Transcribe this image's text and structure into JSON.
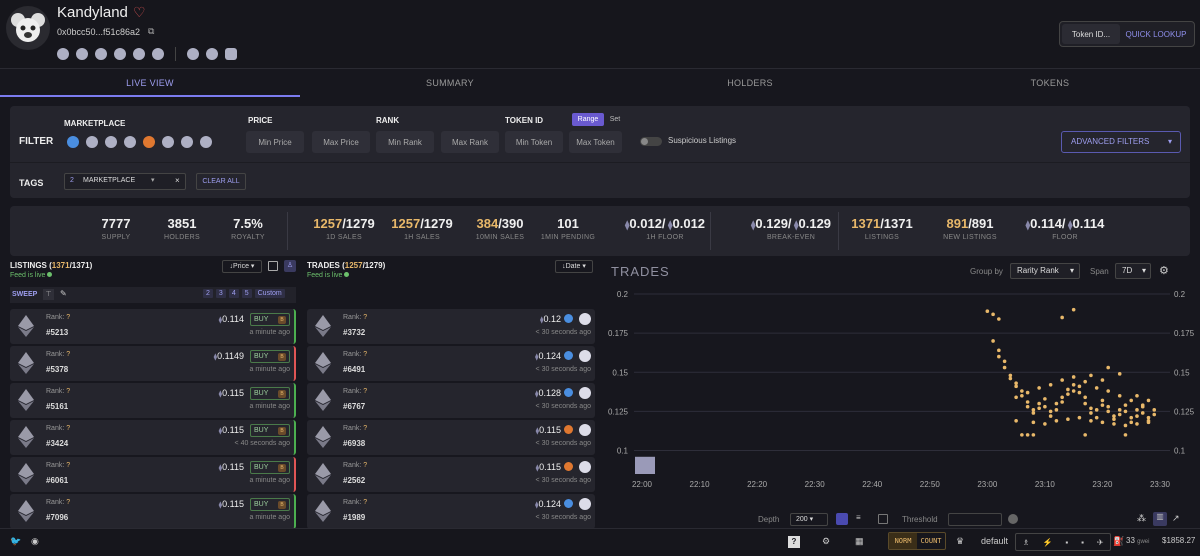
{
  "header": {
    "collection_name": "Kandyland",
    "address": "0x0bcc50...f51c86a2",
    "lookup_placeholder": "Token ID...",
    "lookup_button": "QUICK LOOKUP"
  },
  "tabs": [
    "LIVE VIEW",
    "SUMMARY",
    "HOLDERS",
    "TOKENS"
  ],
  "filter": {
    "title": "FILTER",
    "marketplace_label": "MARKETPLACE",
    "price_label": "PRICE",
    "rank_label": "RANK",
    "token_label": "TOKEN ID",
    "range_btn": "Range",
    "set_btn": "Set",
    "min_price": "Min Price",
    "max_price": "Max Price",
    "min_rank": "Min Rank",
    "max_rank": "Max Rank",
    "min_token": "Min Token",
    "max_token": "Max Token",
    "suspicious": "Suspicious Listings",
    "advanced": "ADVANCED FILTERS",
    "tags_label": "TAGS",
    "tag_count": "2",
    "tag_name": "MARKETPLACE",
    "clear_all": "CLEAR ALL"
  },
  "stats": [
    {
      "v1": "7777",
      "v2": "",
      "l": "SUPPLY",
      "pre": ""
    },
    {
      "v1": "3851",
      "v2": "",
      "l": "HOLDERS",
      "pre": ""
    },
    {
      "v1": "7.5%",
      "v2": "",
      "l": "ROYALTY",
      "pre": ""
    },
    {
      "v1": "1257",
      "v2": "/1279",
      "l": "1D SALES",
      "pre": ""
    },
    {
      "v1": "1257",
      "v2": "/1279",
      "l": "1H SALES",
      "pre": ""
    },
    {
      "v1": "384",
      "v2": "/390",
      "l": "10MIN SALES",
      "pre": ""
    },
    {
      "v1": "101",
      "v2": "",
      "l": "1MIN PENDING",
      "pre": ""
    },
    {
      "v1": "0.012/",
      "v2": "0.012",
      "l": "1H FLOOR",
      "pre": "eth"
    },
    {
      "v1": "0.129/",
      "v2": "0.129",
      "l": "BREAK-EVEN",
      "pre": "eth"
    },
    {
      "v1": "1371",
      "v2": "/1371",
      "l": "LISTINGS",
      "pre": ""
    },
    {
      "v1": "891",
      "v2": "/891",
      "l": "NEW LISTINGS",
      "pre": ""
    },
    {
      "v1": "0.114/",
      "v2": "0.114",
      "l": "FLOOR",
      "pre": "eth"
    }
  ],
  "listings": {
    "title_pre": "LISTINGS (",
    "count": "1371",
    "title_post": "/1371)",
    "feed": "Feed is live",
    "sort": "Price",
    "sweep": "SWEEP",
    "sweep_opts": [
      "2",
      "3",
      "4",
      "5",
      "Custom"
    ],
    "rank_label": "Rank:",
    "rank_value": "?",
    "buy": "BUY",
    "rows": [
      {
        "id": "#5213",
        "price": "0.114",
        "time": "a minute ago",
        "accent": "#4caf50"
      },
      {
        "id": "#5378",
        "price": "0.1149",
        "time": "a minute ago",
        "accent": "#e05555"
      },
      {
        "id": "#5161",
        "price": "0.115",
        "time": "a minute ago",
        "accent": "#4caf50"
      },
      {
        "id": "#3424",
        "price": "0.115",
        "time": "< 40 seconds ago",
        "accent": "#4caf50"
      },
      {
        "id": "#6061",
        "price": "0.115",
        "time": "a minute ago",
        "accent": "#e05555"
      },
      {
        "id": "#7096",
        "price": "0.115",
        "time": "a minute ago",
        "accent": "#4caf50"
      }
    ]
  },
  "trades": {
    "title_pre": "TRADES (",
    "count": "1257",
    "title_post": "/1279)",
    "feed": "Feed is live",
    "sort": "Date",
    "rows": [
      {
        "id": "#3732",
        "price": "0.12",
        "time": "< 30 seconds ago",
        "mk": "#4a8ee0"
      },
      {
        "id": "#6491",
        "price": "0.124",
        "time": "< 30 seconds ago",
        "mk": "#4a8ee0"
      },
      {
        "id": "#6767",
        "price": "0.128",
        "time": "< 30 seconds ago",
        "mk": "#4a8ee0"
      },
      {
        "id": "#6938",
        "price": "0.115",
        "time": "< 30 seconds ago",
        "mk": "#e07830"
      },
      {
        "id": "#2562",
        "price": "0.115",
        "time": "< 30 seconds ago",
        "mk": "#e07830"
      },
      {
        "id": "#1989",
        "price": "0.124",
        "time": "< 30 seconds ago",
        "mk": "#4a8ee0"
      }
    ]
  },
  "chart_panel": {
    "title": "TRADES",
    "group_by_label": "Group by",
    "group_by_value": "Rarity Rank",
    "span_label": "Span",
    "span_value": "7D",
    "depth_label": "Depth",
    "depth_value": "200",
    "threshold_label": "Threshold"
  },
  "chart_data": {
    "type": "scatter",
    "title": "TRADES",
    "xlabel": "",
    "ylabel": "",
    "x_ticks": [
      "22:00",
      "22:10",
      "22:20",
      "22:30",
      "22:40",
      "22:50",
      "23:00",
      "23:10",
      "23:20",
      "23:30"
    ],
    "y_ticks": [
      0.1,
      0.125,
      0.15,
      0.175,
      0.2
    ],
    "ylim": [
      0.085,
      0.2
    ],
    "grid": true,
    "series": [
      {
        "color": "#e8b86a",
        "points": [
          [
            "23:00",
            0.189
          ],
          [
            "23:01",
            0.187
          ],
          [
            "23:02",
            0.184
          ],
          [
            "23:13",
            0.185
          ],
          [
            "23:15",
            0.19
          ],
          [
            "23:01",
            0.17
          ],
          [
            "23:02",
            0.164
          ],
          [
            "23:02",
            0.16
          ],
          [
            "23:03",
            0.157
          ],
          [
            "23:03",
            0.153
          ],
          [
            "23:04",
            0.148
          ],
          [
            "23:04",
            0.146
          ],
          [
            "23:05",
            0.143
          ],
          [
            "23:05",
            0.141
          ],
          [
            "23:06",
            0.138
          ],
          [
            "23:06",
            0.135
          ],
          [
            "23:07",
            0.131
          ],
          [
            "23:07",
            0.128
          ],
          [
            "23:08",
            0.126
          ],
          [
            "23:08",
            0.124
          ],
          [
            "23:09",
            0.127
          ],
          [
            "23:09",
            0.13
          ],
          [
            "23:10",
            0.133
          ],
          [
            "23:10",
            0.128
          ],
          [
            "23:11",
            0.125
          ],
          [
            "23:11",
            0.122
          ],
          [
            "23:12",
            0.126
          ],
          [
            "23:12",
            0.13
          ],
          [
            "23:13",
            0.134
          ],
          [
            "23:13",
            0.131
          ],
          [
            "23:14",
            0.136
          ],
          [
            "23:14",
            0.139
          ],
          [
            "23:15",
            0.142
          ],
          [
            "23:15",
            0.138
          ],
          [
            "23:16",
            0.141
          ],
          [
            "23:16",
            0.137
          ],
          [
            "23:17",
            0.134
          ],
          [
            "23:17",
            0.13
          ],
          [
            "23:18",
            0.127
          ],
          [
            "23:18",
            0.124
          ],
          [
            "23:19",
            0.121
          ],
          [
            "23:19",
            0.126
          ],
          [
            "23:20",
            0.129
          ],
          [
            "23:20",
            0.132
          ],
          [
            "23:21",
            0.128
          ],
          [
            "23:21",
            0.125
          ],
          [
            "23:22",
            0.122
          ],
          [
            "23:22",
            0.12
          ],
          [
            "23:23",
            0.123
          ],
          [
            "23:23",
            0.126
          ],
          [
            "23:24",
            0.129
          ],
          [
            "23:24",
            0.125
          ],
          [
            "23:25",
            0.121
          ],
          [
            "23:25",
            0.118
          ],
          [
            "23:26",
            0.122
          ],
          [
            "23:26",
            0.126
          ],
          [
            "23:27",
            0.128
          ],
          [
            "23:27",
            0.124
          ],
          [
            "23:28",
            0.121
          ],
          [
            "23:28",
            0.119
          ],
          [
            "23:29",
            0.123
          ],
          [
            "23:29",
            0.126
          ],
          [
            "23:05",
            0.134
          ],
          [
            "23:07",
            0.137
          ],
          [
            "23:09",
            0.14
          ],
          [
            "23:11",
            0.142
          ],
          [
            "23:13",
            0.145
          ],
          [
            "23:15",
            0.147
          ],
          [
            "23:17",
            0.144
          ],
          [
            "23:19",
            0.14
          ],
          [
            "23:21",
            0.138
          ],
          [
            "23:23",
            0.135
          ],
          [
            "23:25",
            0.132
          ],
          [
            "23:27",
            0.129
          ],
          [
            "23:05",
            0.119
          ],
          [
            "23:08",
            0.118
          ],
          [
            "23:10",
            0.117
          ],
          [
            "23:12",
            0.119
          ],
          [
            "23:14",
            0.12
          ],
          [
            "23:16",
            0.121
          ],
          [
            "23:18",
            0.119
          ],
          [
            "23:20",
            0.118
          ],
          [
            "23:22",
            0.117
          ],
          [
            "23:24",
            0.116
          ],
          [
            "23:26",
            0.117
          ],
          [
            "23:28",
            0.118
          ],
          [
            "23:06",
            0.11
          ],
          [
            "23:07",
            0.11
          ],
          [
            "23:08",
            0.11
          ],
          [
            "23:17",
            0.11
          ],
          [
            "23:24",
            0.11
          ],
          [
            "23:21",
            0.153
          ],
          [
            "23:23",
            0.149
          ],
          [
            "23:18",
            0.148
          ],
          [
            "23:20",
            0.145
          ],
          [
            "23:26",
            0.135
          ],
          [
            "23:28",
            0.132
          ]
        ]
      }
    ],
    "bars": [
      {
        "x": "22:00",
        "value": 0.096
      }
    ]
  },
  "bottom": {
    "norm": "NORM",
    "count": "COUNT",
    "default": "default",
    "gas": "33",
    "gas_unit": "gwei",
    "eth_price": "$1858.27"
  }
}
